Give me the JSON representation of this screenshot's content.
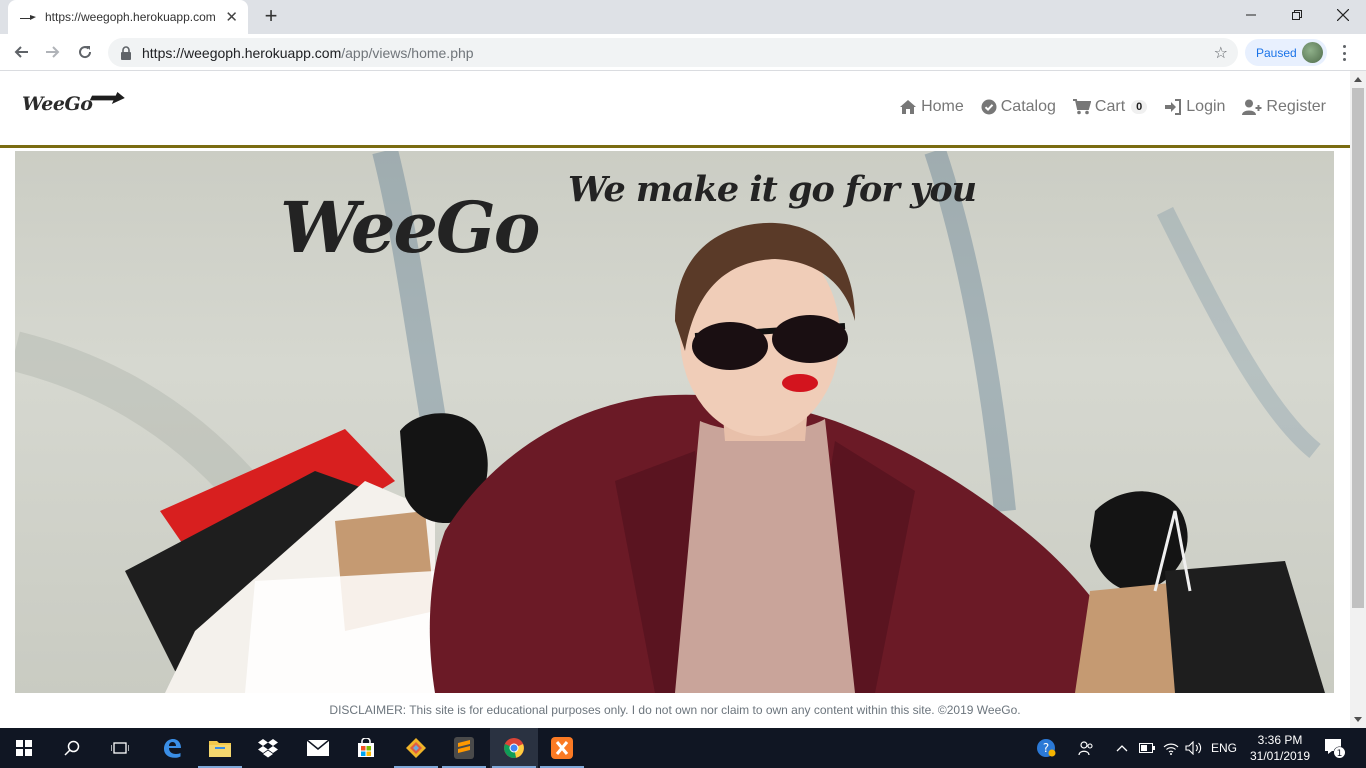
{
  "browser": {
    "tab_title": "https://weegoph.herokuapp.com",
    "new_tab_symbol": "+",
    "url_host": "https://weegoph.herokuapp.com",
    "url_path": "/app/views/home.php",
    "profile_status": "Paused"
  },
  "site": {
    "brand": "WeeGo",
    "nav": {
      "home": "Home",
      "catalog": "Catalog",
      "cart": "Cart",
      "cart_count": "0",
      "login": "Login",
      "register": "Register"
    },
    "hero": {
      "title": "WeeGo",
      "tagline": "We make it go for you"
    },
    "disclaimer": "DISCLAIMER: This site is for educational purposes only. I do not own nor claim to own any content within this site. ©2019 WeeGo."
  },
  "taskbar": {
    "language": "ENG",
    "time": "3:36 PM",
    "date": "31/01/2019",
    "notification_count": "1",
    "icons": [
      "windows-start-icon",
      "search-icon",
      "task-view-icon",
      "edge-icon",
      "file-explorer-icon",
      "dropbox-icon",
      "mail-icon",
      "store-icon",
      "git-icon",
      "sublime-icon",
      "chrome-icon",
      "xampp-icon"
    ]
  },
  "colors": {
    "nav_underline": "#7a6c12",
    "taskbar_bg": "#101623",
    "coat": "#6b1a26"
  }
}
